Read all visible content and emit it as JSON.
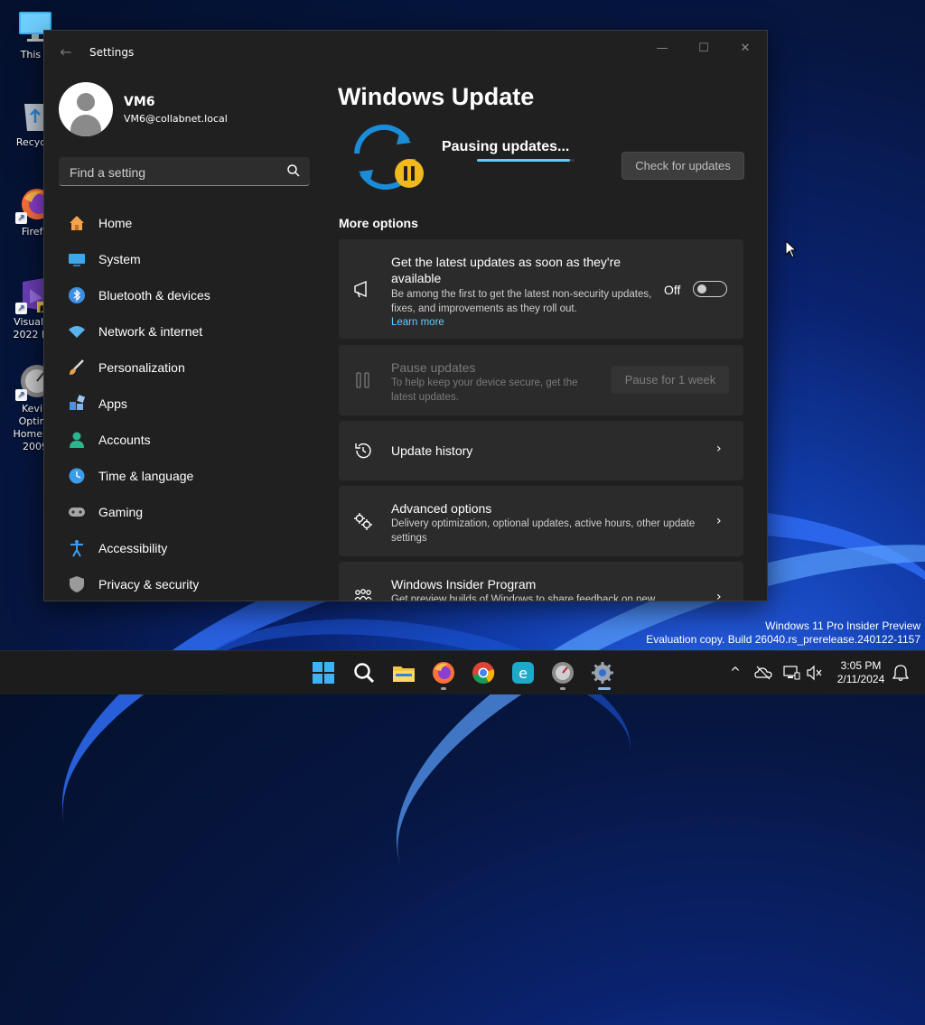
{
  "desktop": {
    "icons": [
      {
        "label": "This P"
      },
      {
        "label": "Recycle"
      },
      {
        "label": "Firefo"
      },
      {
        "label": "Visual St\n2022 Pre"
      },
      {
        "label": "Kevin\nOptimi\nHome Ec\n2009"
      }
    ],
    "shortcut_badge": "PI"
  },
  "window": {
    "title": "Settings",
    "back_glyph": "←",
    "minimize_glyph": "—",
    "maximize_glyph": "☐",
    "close_glyph": "✕"
  },
  "user": {
    "name": "VM6",
    "email": "VM6@collabnet.local"
  },
  "search": {
    "placeholder": "Find a setting",
    "value": ""
  },
  "nav": [
    {
      "label": "Home",
      "icon": "home-icon",
      "color": "#f3a24e"
    },
    {
      "label": "System",
      "icon": "system-icon",
      "color": "#3fa7e8"
    },
    {
      "label": "Bluetooth & devices",
      "icon": "bluetooth-icon",
      "color": "#3d8fe4"
    },
    {
      "label": "Network & internet",
      "icon": "wifi-icon",
      "color": "#5bb2ef"
    },
    {
      "label": "Personalization",
      "icon": "brush-icon",
      "color": "#e9a24a"
    },
    {
      "label": "Apps",
      "icon": "apps-icon",
      "color": "#4a90e2"
    },
    {
      "label": "Accounts",
      "icon": "accounts-icon",
      "color": "#2bb58e"
    },
    {
      "label": "Time & language",
      "icon": "globe-icon",
      "color": "#3a9de8"
    },
    {
      "label": "Gaming",
      "icon": "gamepad-icon",
      "color": "#a6a6a6"
    },
    {
      "label": "Accessibility",
      "icon": "accessibility-icon",
      "color": "#3b9df1"
    },
    {
      "label": "Privacy & security",
      "icon": "shield-icon",
      "color": "#9a9a9a"
    }
  ],
  "main": {
    "title": "Windows Update",
    "status": "Pausing updates...",
    "status_progress": 0.95,
    "check_button": "Check for updates",
    "more_options": "More options",
    "latest_updates": {
      "title": "Get the latest updates as soon as they're available",
      "description": "Be among the first to get the latest non-security updates, fixes, and improvements as they roll out.",
      "learn_more": "Learn more",
      "toggle_label": "Off",
      "toggle_on": false
    },
    "pause_updates": {
      "title": "Pause updates",
      "description": "To help keep your device secure, get the latest updates.",
      "button": "Pause for 1 week"
    },
    "update_history": {
      "title": "Update history"
    },
    "advanced_options": {
      "title": "Advanced options",
      "description": "Delivery optimization, optional updates, active hours, other update settings"
    },
    "insider_program": {
      "title": "Windows Insider Program",
      "description": "Get preview builds of Windows to share feedback on new"
    },
    "chevron_glyph": "›"
  },
  "watermark": {
    "line1": "Windows 11 Pro Insider Preview",
    "line2": "Evaluation copy. Build 26040.rs_prerelease.240122-1157"
  },
  "taskbar": {
    "apps": [
      "start-icon",
      "search-icon",
      "file-explorer-icon",
      "firefox-icon",
      "chrome-icon",
      "edge-icon",
      "optimizer-app-icon",
      "settings-gear-icon"
    ],
    "tray_chevron": "^",
    "time": "3:05 PM",
    "date": "2/11/2024"
  },
  "colors": {
    "accent": "#60cdff",
    "window_bg": "#202020",
    "card_bg": "#2b2b2b"
  }
}
